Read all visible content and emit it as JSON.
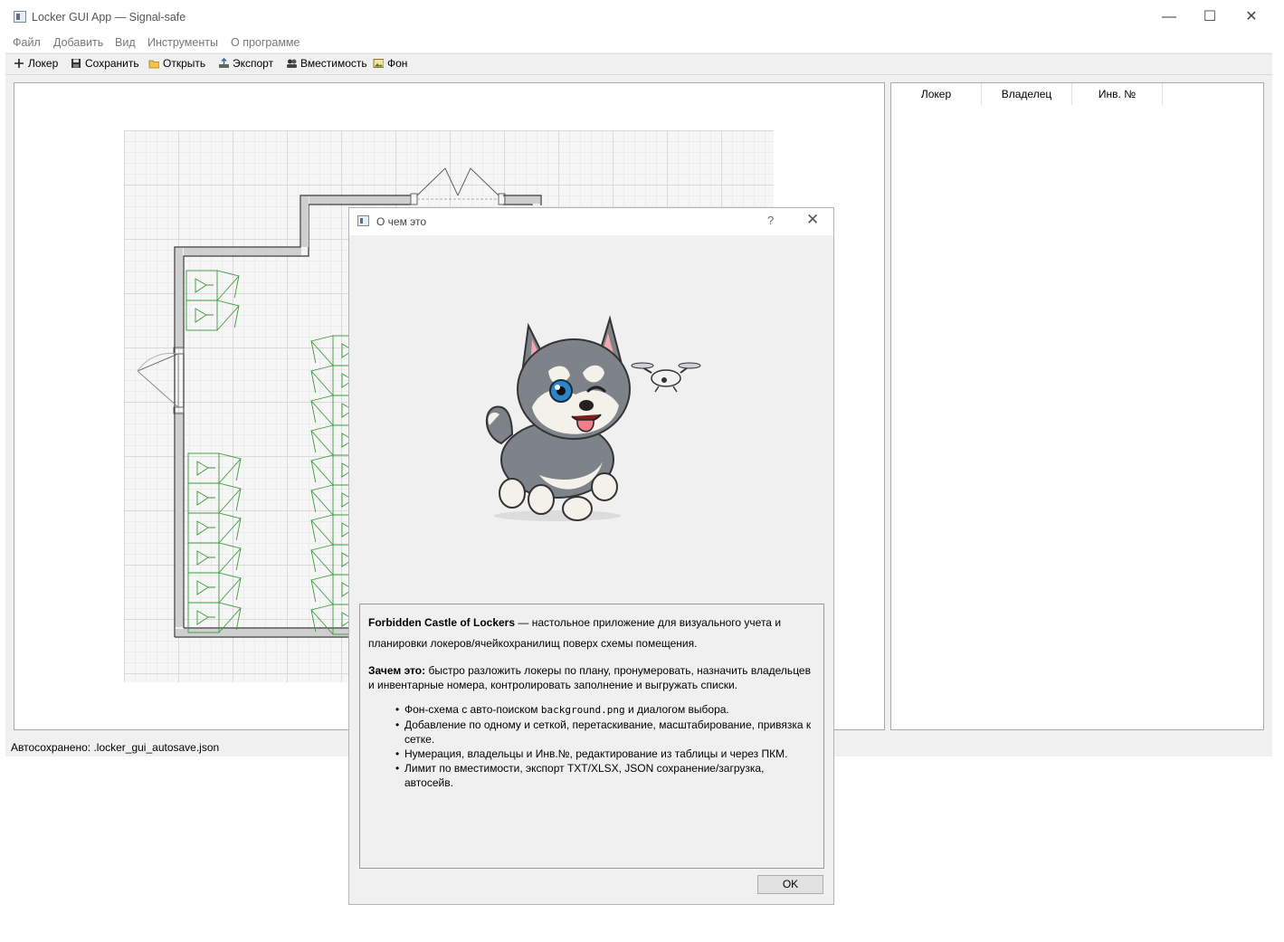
{
  "window": {
    "title": "Locker GUI App — Signal-safe",
    "controls": {
      "minimize": "—",
      "maximize": "☐",
      "close": "✕"
    }
  },
  "menu": [
    "Файл",
    "Добавить",
    "Вид",
    "Инструменты",
    "О программе"
  ],
  "toolbar": {
    "locker": "Локер",
    "save": "Сохранить",
    "open": "Открыть",
    "export": "Экспорт",
    "capacity": "Вместимость",
    "background": "Фон"
  },
  "table": {
    "headers": [
      "Локер",
      "Владелец",
      "Инв. №"
    ],
    "rows": []
  },
  "status": {
    "text": "Автосохранено: .locker_gui_autosave.json"
  },
  "dialog": {
    "title": "О чем это",
    "help": "?",
    "close": "✕",
    "app_name": "Forbidden Castle of Lockers",
    "lead": " — настольное приложение для визуального учета и планировки локеров/ячейкохранилищ поверх схемы помещения.",
    "why_label": "Зачем это:",
    "why_text": " быстро разложить локеры по плану, пронумеровать, назначить владельцев и инвентарные номера, контролировать заполнение и выгружать списки.",
    "features": {
      "f1_pre": "Фон-схема с авто-поиском ",
      "f1_code": "background.png",
      "f1_post": " и диалогом выбора.",
      "f2": "Добавление по одному и сеткой, перетаскивание, масштабирование, привязка к сетке.",
      "f3": "Нумерация, владельцы и Инв.№, редактирование из таблицы и через ПКМ.",
      "f4": "Лимит по вместимости, экспорт TXT/XLSX, JSON сохранение/загрузка, автосейв."
    },
    "ok": "OK"
  },
  "colors": {
    "locker_green": "#3a9a3a",
    "wall": "#333333",
    "grid": "#d9d9d9"
  }
}
